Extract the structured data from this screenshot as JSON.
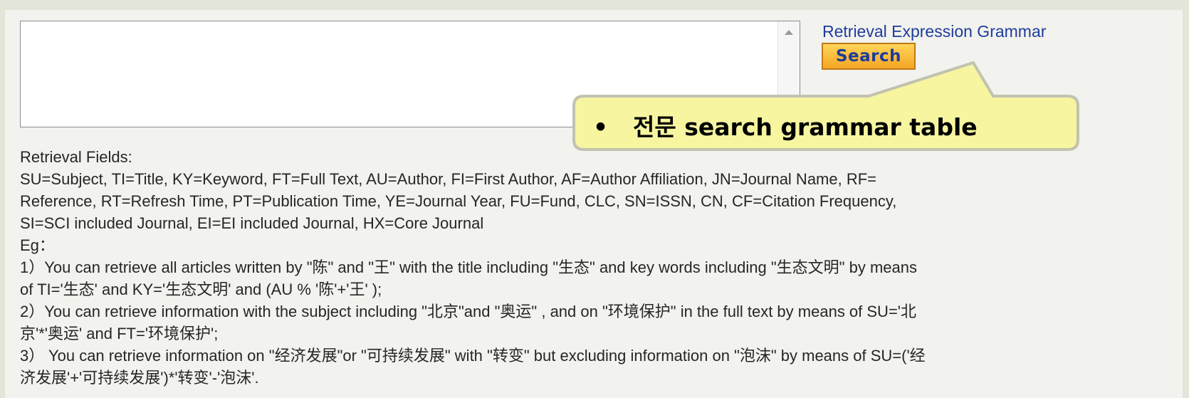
{
  "toolbar": {
    "grammar_link": "Retrieval Expression Grammar",
    "search_label": "Search"
  },
  "callout": {
    "bullet": "•",
    "text": "전문 search grammar table"
  },
  "help": {
    "heading": "Retrieval Fields:",
    "fields_lines": [
      "SU=Subject, TI=Title, KY=Keyword, FT=Full Text, AU=Author, FI=First Author, AF=Author Affiliation, JN=Journal Name, RF=",
      "Reference, RT=Refresh Time, PT=Publication Time, YE=Journal Year, FU=Fund, CLC, SN=ISSN, CN, CF=Citation Frequency,",
      "SI=SCI included Journal, EI=EI included Journal, HX=Core Journal"
    ],
    "eg_label": "Eg：",
    "examples": [
      "1）You can retrieve all articles written by \"陈\" and \"王\" with the title including \"生态\" and key words including \"生态文明\" by means",
      "of TI='生态' and KY='生态文明' and (AU % '陈'+'王' );",
      "2）You can retrieve information with the subject including \"北京\"and \"奥运\" , and on \"环境保护\" in the full text by means of SU='北",
      "京'*'奥运' and FT='环境保护';",
      "3） You can retrieve information on \"经济发展\"or \"可持续发展\" with \"转变\" but excluding information on \"泡沫\" by means of SU=('经",
      "济发展'+'可持续发展')*'转变'-'泡沫'."
    ]
  },
  "colors": {
    "link": "#1e3c9c",
    "button_fill": "#f5a623",
    "callout_fill": "#f7f5a0",
    "callout_border": "#c2c2b0"
  }
}
